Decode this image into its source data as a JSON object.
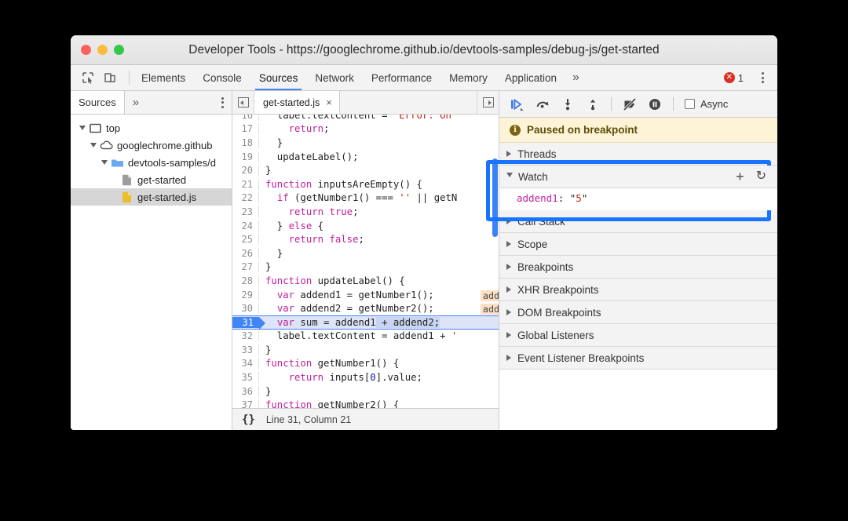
{
  "window": {
    "title": "Developer Tools - https://googlechrome.github.io/devtools-samples/debug-js/get-started",
    "traffic": {
      "close": "close-button",
      "minimize": "minimize-button",
      "zoom": "zoom-button"
    }
  },
  "toolbar": {
    "inspect_icon": "inspect-element-icon",
    "device_icon": "device-toolbar-icon",
    "tabs": [
      {
        "label": "Elements",
        "selected": false
      },
      {
        "label": "Console",
        "selected": false
      },
      {
        "label": "Sources",
        "selected": true
      },
      {
        "label": "Network",
        "selected": false
      },
      {
        "label": "Performance",
        "selected": false
      },
      {
        "label": "Memory",
        "selected": false
      },
      {
        "label": "Application",
        "selected": false
      }
    ],
    "more_tabs": "»",
    "error_count": "1",
    "error_glyph": "✕",
    "menu_icon": "more-options-icon"
  },
  "navigator": {
    "tab_label": "Sources",
    "more_label": "»",
    "tree": [
      {
        "label": "top",
        "icon": "frame-icon",
        "indent": 0,
        "expanded": true,
        "selected": false
      },
      {
        "label": "googlechrome.github",
        "icon": "cloud-icon",
        "indent": 1,
        "expanded": true,
        "selected": false
      },
      {
        "label": "devtools-samples/d",
        "icon": "folder-icon",
        "indent": 2,
        "expanded": true,
        "selected": false
      },
      {
        "label": "get-started",
        "icon": "document-icon",
        "indent": 3,
        "expanded": false,
        "selected": false
      },
      {
        "label": "get-started.js",
        "icon": "js-file-icon",
        "indent": 3,
        "expanded": false,
        "selected": true
      }
    ]
  },
  "editor": {
    "tab_label": "get-started.js",
    "tab_close": "×",
    "prev_icon": "show-navigator-icon",
    "next_icon": "show-debugger-icon",
    "status": {
      "format_icon": "{}",
      "position": "Line 31, Column 21"
    },
    "lines": [
      {
        "n": "16",
        "partial": true,
        "tokens": [
          {
            "t": "  label.textContent = ",
            "c": ""
          },
          {
            "t": "'Error: on",
            "c": "str"
          }
        ]
      },
      {
        "n": "17",
        "tokens": [
          {
            "t": "    ",
            "c": ""
          },
          {
            "t": "return",
            "c": "kw"
          },
          {
            "t": ";",
            "c": ""
          }
        ]
      },
      {
        "n": "18",
        "tokens": [
          {
            "t": "  }",
            "c": ""
          }
        ]
      },
      {
        "n": "19",
        "tokens": [
          {
            "t": "  updateLabel();",
            "c": ""
          }
        ]
      },
      {
        "n": "20",
        "tokens": [
          {
            "t": "}",
            "c": ""
          }
        ]
      },
      {
        "n": "21",
        "tokens": [
          {
            "t": "function",
            "c": "kw"
          },
          {
            "t": " inputsAreEmpty() {",
            "c": ""
          }
        ]
      },
      {
        "n": "22",
        "tokens": [
          {
            "t": "  ",
            "c": ""
          },
          {
            "t": "if",
            "c": "kw"
          },
          {
            "t": " (getNumber1() === ",
            "c": ""
          },
          {
            "t": "''",
            "c": "str"
          },
          {
            "t": " || getN",
            "c": ""
          }
        ]
      },
      {
        "n": "23",
        "tokens": [
          {
            "t": "    ",
            "c": ""
          },
          {
            "t": "return",
            "c": "kw"
          },
          {
            "t": " ",
            "c": ""
          },
          {
            "t": "true",
            "c": "kw"
          },
          {
            "t": ";",
            "c": ""
          }
        ]
      },
      {
        "n": "24",
        "tokens": [
          {
            "t": "  } ",
            "c": ""
          },
          {
            "t": "else",
            "c": "kw"
          },
          {
            "t": " {",
            "c": ""
          }
        ]
      },
      {
        "n": "25",
        "tokens": [
          {
            "t": "    ",
            "c": ""
          },
          {
            "t": "return",
            "c": "kw"
          },
          {
            "t": " ",
            "c": ""
          },
          {
            "t": "false",
            "c": "kw"
          },
          {
            "t": ";",
            "c": ""
          }
        ]
      },
      {
        "n": "26",
        "tokens": [
          {
            "t": "  }",
            "c": ""
          }
        ]
      },
      {
        "n": "27",
        "tokens": [
          {
            "t": "}",
            "c": ""
          }
        ]
      },
      {
        "n": "28",
        "tokens": [
          {
            "t": "function",
            "c": "kw"
          },
          {
            "t": " updateLabel() {",
            "c": ""
          }
        ]
      },
      {
        "n": "29",
        "inline": "add",
        "tokens": [
          {
            "t": "  ",
            "c": ""
          },
          {
            "t": "var",
            "c": "kw"
          },
          {
            "t": " addend1 = getNumber1();",
            "c": ""
          }
        ]
      },
      {
        "n": "30",
        "inline": "add",
        "tokens": [
          {
            "t": "  ",
            "c": ""
          },
          {
            "t": "var",
            "c": "kw"
          },
          {
            "t": " addend2 = getNumber2();",
            "c": ""
          }
        ]
      },
      {
        "n": "31",
        "exec": true,
        "tokens": [
          {
            "t": "  ",
            "c": ""
          },
          {
            "t": "var",
            "c": "kw"
          },
          {
            "t": " sum = addend1",
            "c": ""
          },
          {
            "t": " + addend2;",
            "c": "sel-tok"
          }
        ]
      },
      {
        "n": "32",
        "tokens": [
          {
            "t": "  label.textContent = addend1 + ",
            "c": ""
          },
          {
            "t": "'",
            "c": "str"
          }
        ]
      },
      {
        "n": "33",
        "tokens": [
          {
            "t": "}",
            "c": ""
          }
        ]
      },
      {
        "n": "34",
        "tokens": [
          {
            "t": "function",
            "c": "kw"
          },
          {
            "t": " getNumber1() {",
            "c": ""
          }
        ]
      },
      {
        "n": "35",
        "tokens": [
          {
            "t": "    ",
            "c": ""
          },
          {
            "t": "return",
            "c": "kw"
          },
          {
            "t": " inputs[",
            "c": ""
          },
          {
            "t": "0",
            "c": "num"
          },
          {
            "t": "].value;",
            "c": ""
          }
        ]
      },
      {
        "n": "36",
        "tokens": [
          {
            "t": "}",
            "c": ""
          }
        ]
      },
      {
        "n": "37",
        "tokens": [
          {
            "t": "function",
            "c": "kw"
          },
          {
            "t": " getNumber2() {",
            "c": ""
          }
        ]
      }
    ]
  },
  "debugger": {
    "controls": [
      {
        "name": "resume-script-execution",
        "icon": "resume-icon"
      },
      {
        "name": "step-over-next-function-call",
        "icon": "step-over-icon"
      },
      {
        "name": "step-into-next-function-call",
        "icon": "step-into-icon"
      },
      {
        "name": "step-out-of-current-function",
        "icon": "step-out-icon"
      },
      {
        "name": "deactivate-breakpoints",
        "icon": "deactivate-breakpoints-icon"
      },
      {
        "name": "pause-on-exceptions",
        "icon": "pause-on-exceptions-icon"
      }
    ],
    "async_label": "Async",
    "async_checked": false,
    "paused_message": "Paused on breakpoint",
    "paused_icon": "info-icon",
    "sections": [
      {
        "label": "Threads",
        "expanded": false
      },
      {
        "label": "Call Stack",
        "expanded": false
      },
      {
        "label": "Scope",
        "expanded": false
      },
      {
        "label": "Breakpoints",
        "expanded": false
      },
      {
        "label": "XHR Breakpoints",
        "expanded": false
      },
      {
        "label": "DOM Breakpoints",
        "expanded": false
      },
      {
        "label": "Global Listeners",
        "expanded": false
      },
      {
        "label": "Event Listener Breakpoints",
        "expanded": false
      }
    ],
    "watch": {
      "label": "Watch",
      "expanded": true,
      "add_label": "+",
      "refresh_label": "↻",
      "entries": [
        {
          "name": "addend1",
          "separator": ": ",
          "quote": "\"",
          "value": "5"
        }
      ],
      "highlight_color": "#1a73ff"
    }
  }
}
